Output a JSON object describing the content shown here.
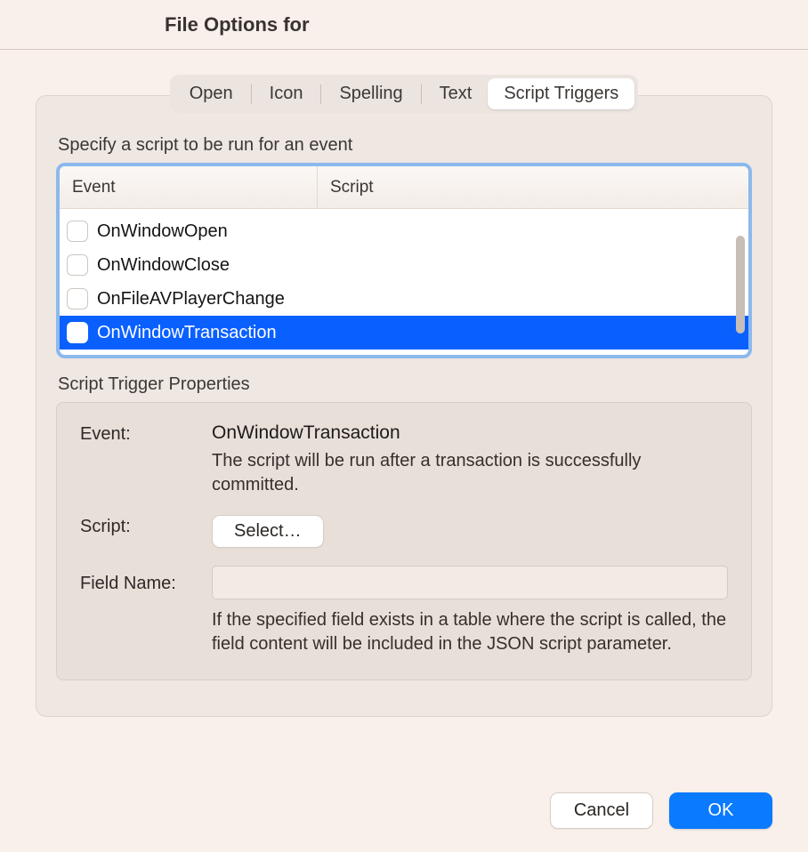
{
  "window": {
    "title": "File Options for"
  },
  "tabs": {
    "open": "Open",
    "icon": "Icon",
    "spelling": "Spelling",
    "text": "Text",
    "script_triggers": "Script Triggers"
  },
  "main": {
    "instruction": "Specify a script to be run for an event",
    "columns": {
      "event": "Event",
      "script": "Script"
    },
    "events": [
      {
        "label": "OnWindowOpen",
        "selected": false
      },
      {
        "label": "OnWindowClose",
        "selected": false
      },
      {
        "label": "OnFileAVPlayerChange",
        "selected": false
      },
      {
        "label": "OnWindowTransaction",
        "selected": true
      }
    ]
  },
  "properties": {
    "section_label": "Script Trigger Properties",
    "event_label": "Event:",
    "event_name": "OnWindowTransaction",
    "event_desc": "The script will be run after a transaction is successfully committed.",
    "script_label": "Script:",
    "select_button": "Select…",
    "fieldname_label": "Field Name:",
    "fieldname_value": "",
    "fieldname_desc": "If the specified field exists in a table where the script is called, the field content will be included in the JSON script parameter."
  },
  "footer": {
    "cancel": "Cancel",
    "ok": "OK"
  }
}
